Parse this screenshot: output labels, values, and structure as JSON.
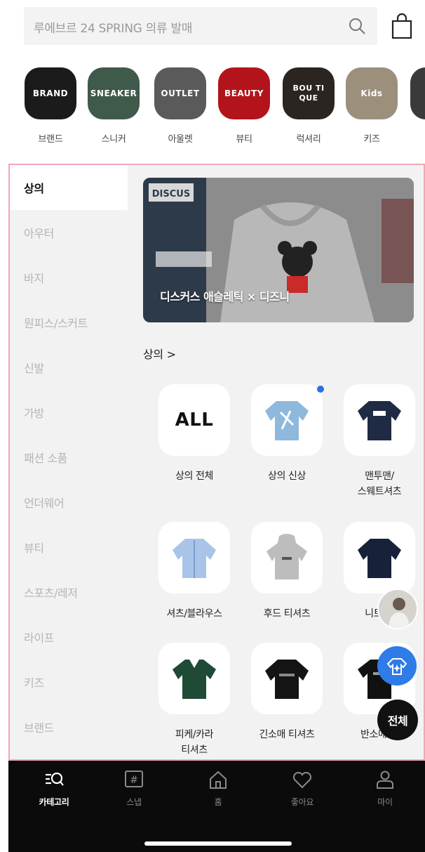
{
  "search": {
    "placeholder": "루에브르 24 SPRING 의류 발매"
  },
  "shortcuts": [
    {
      "name": "브랜드",
      "tile_text": "BRAND",
      "color": "#1b1b1b"
    },
    {
      "name": "스니커",
      "tile_text": "SNEAKER",
      "color": "#3f5a4a"
    },
    {
      "name": "아울렛",
      "tile_text": "OUTLET",
      "color": "#5a5a5a"
    },
    {
      "name": "뷰티",
      "tile_text": "BEAUTY",
      "color": "#b3141c"
    },
    {
      "name": "럭셔리",
      "tile_text": "BOU TI QUE",
      "color": "#2a2520"
    },
    {
      "name": "키즈",
      "tile_text": "Kids",
      "color": "#9c8f7c"
    }
  ],
  "sidebar": {
    "items": [
      {
        "label": "상의",
        "active": true
      },
      {
        "label": "아우터"
      },
      {
        "label": "바지"
      },
      {
        "label": "원피스/스커트"
      },
      {
        "label": "신발"
      },
      {
        "label": "가방"
      },
      {
        "label": "패션 소품"
      },
      {
        "label": "언더웨어"
      },
      {
        "label": "뷰티"
      },
      {
        "label": "스포츠/레저"
      },
      {
        "label": "라이프"
      },
      {
        "label": "키즈"
      },
      {
        "label": "브랜드"
      }
    ]
  },
  "banner": {
    "caption": "디스커스 애슬레틱 × 디즈니",
    "logo": "DISCUS"
  },
  "section": {
    "title": "상의 >"
  },
  "grid": [
    {
      "label": "상의 전체",
      "icon": "all-text",
      "text": "ALL"
    },
    {
      "label": "상의 신상",
      "icon": "new-sweatshirt-icon",
      "new": true
    },
    {
      "label": "맨투맨/\n스웨트셔츠",
      "icon": "sweatshirt-icon"
    },
    {
      "label": "셔츠/블라우스",
      "icon": "shirt-icon"
    },
    {
      "label": "후드 티셔츠",
      "icon": "hoodie-icon"
    },
    {
      "label": "니트/스",
      "icon": "knit-icon"
    },
    {
      "label": "피케/카라\n티셔츠",
      "icon": "polo-icon"
    },
    {
      "label": "긴소매 티셔츠",
      "icon": "longsleeve-icon"
    },
    {
      "label": "반소매 티",
      "icon": "tshirt-icon"
    }
  ],
  "floating": {
    "all_label": "전체"
  },
  "bottom_nav": [
    {
      "label": "카테고리",
      "active": true
    },
    {
      "label": "스냅"
    },
    {
      "label": "홈"
    },
    {
      "label": "좋아요"
    },
    {
      "label": "마이"
    }
  ]
}
